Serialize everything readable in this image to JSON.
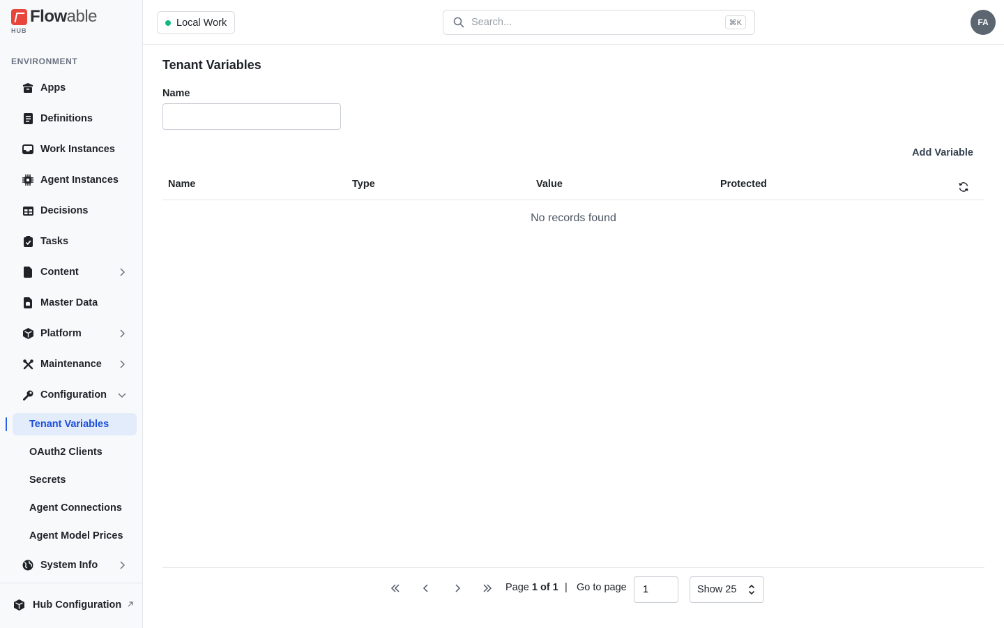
{
  "brand": {
    "name_bold": "Flow",
    "name_light": "able",
    "sub": "HUB",
    "accent": "#e8453c"
  },
  "sidebar": {
    "section_label": "ENVIRONMENT",
    "items": [
      {
        "label": "Apps",
        "icon": "box-icon"
      },
      {
        "label": "Definitions",
        "icon": "document-list-icon"
      },
      {
        "label": "Work Instances",
        "icon": "inbox-icon"
      },
      {
        "label": "Agent Instances",
        "icon": "chip-icon"
      },
      {
        "label": "Decisions",
        "icon": "table-icon"
      },
      {
        "label": "Tasks",
        "icon": "clipboard-check-icon"
      },
      {
        "label": "Content",
        "icon": "file-icon"
      },
      {
        "label": "Master Data",
        "icon": "database-file-icon"
      },
      {
        "label": "Platform",
        "icon": "cube-icon"
      },
      {
        "label": "Maintenance",
        "icon": "tools-icon"
      },
      {
        "label": "Configuration",
        "icon": "wrench-icon"
      }
    ],
    "config_sub_items": [
      {
        "label": "Tenant Variables"
      },
      {
        "label": "OAuth2 Clients"
      },
      {
        "label": "Secrets"
      },
      {
        "label": "Agent Connections"
      },
      {
        "label": "Agent Model Prices"
      }
    ],
    "system_info": {
      "label": "System Info",
      "icon": "globe-icon"
    },
    "footer": {
      "label": "Hub Configuration",
      "icon": "cube-icon"
    }
  },
  "header": {
    "workspace_label": "Local Work",
    "workspace_status_color": "#10b981",
    "search_placeholder": "Search...",
    "search_shortcut": "⌘K",
    "avatar_initials": "FA"
  },
  "main": {
    "title": "Tenant Variables",
    "filter_label": "Name",
    "filter_value": "",
    "add_button": "Add Variable",
    "columns": [
      "Name",
      "Type",
      "Value",
      "Protected"
    ],
    "empty_text": "No records found"
  },
  "pagination": {
    "page_word": "Page",
    "page_of": "1 of 1",
    "separator": "|",
    "goto_label": "Go to page",
    "goto_value": "1",
    "page_size_label": "Show 25"
  }
}
